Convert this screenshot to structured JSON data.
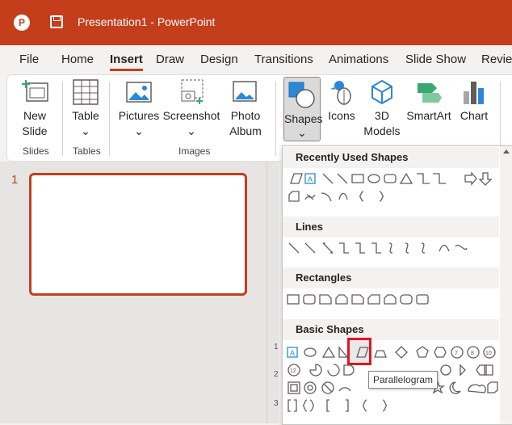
{
  "window": {
    "title": "Presentation1  -  PowerPoint",
    "accent": "#c43e1c"
  },
  "tabs": [
    "File",
    "Home",
    "Insert",
    "Draw",
    "Design",
    "Transitions",
    "Animations",
    "Slide Show",
    "Revie"
  ],
  "ribbon": {
    "new_slide": "New",
    "new_slide2": "Slide",
    "table": "Table",
    "pictures": "Pictures",
    "screenshot": "Screenshot",
    "photo": "Photo",
    "photo2": "Album",
    "shapes": "Shapes",
    "icons": "Icons",
    "models": "3D",
    "models2": "Models",
    "smartart": "SmartArt",
    "chart": "Chart",
    "groups": {
      "slides": "Slides",
      "tables": "Tables",
      "images": "Images"
    }
  },
  "slide_panel": {
    "slide_number": "1"
  },
  "ruler": [
    "1",
    "2",
    "3"
  ],
  "shapes_menu": {
    "sections": {
      "recent": "Recently Used Shapes",
      "lines": "Lines",
      "rectangles": "Rectangles",
      "basic": "Basic Shapes"
    },
    "tooltip": "Parallelogram"
  }
}
